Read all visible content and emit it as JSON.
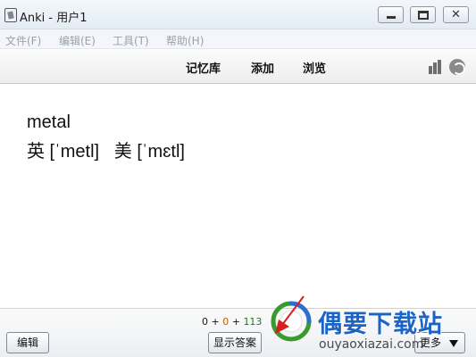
{
  "window": {
    "title": "Anki - 用户1",
    "minimize_icon": "minimize-icon",
    "maximize_icon": "maximize-icon",
    "close_icon": "close-icon",
    "close_glyph": "✕"
  },
  "menu": {
    "items": [
      {
        "label": "文件(F)"
      },
      {
        "label": "编辑(E)"
      },
      {
        "label": "工具(T)"
      },
      {
        "label": "帮助(H)"
      }
    ]
  },
  "toolbar": {
    "links": [
      {
        "label": "记忆库"
      },
      {
        "label": "添加"
      },
      {
        "label": "浏览"
      }
    ],
    "stats_icon": "stats-icon",
    "sync_icon": "sync-icon"
  },
  "card": {
    "word": "metal",
    "phonetic": "英 [ˈmetl]   美 [ˈmɛtl]"
  },
  "footer": {
    "counts": {
      "new": "0",
      "plus1": "+",
      "learning": "0",
      "plus2": "+",
      "review": "113"
    },
    "colors": {
      "new": "#1a1a1a",
      "learning": "#c45e00",
      "review": "#1d7a1d"
    },
    "edit_button": "编辑",
    "show_answer_button": "显示答案",
    "more_button": "更多"
  },
  "watermark": {
    "site_name": "偶要下载站",
    "url": "ouyaoxiazai.com"
  }
}
